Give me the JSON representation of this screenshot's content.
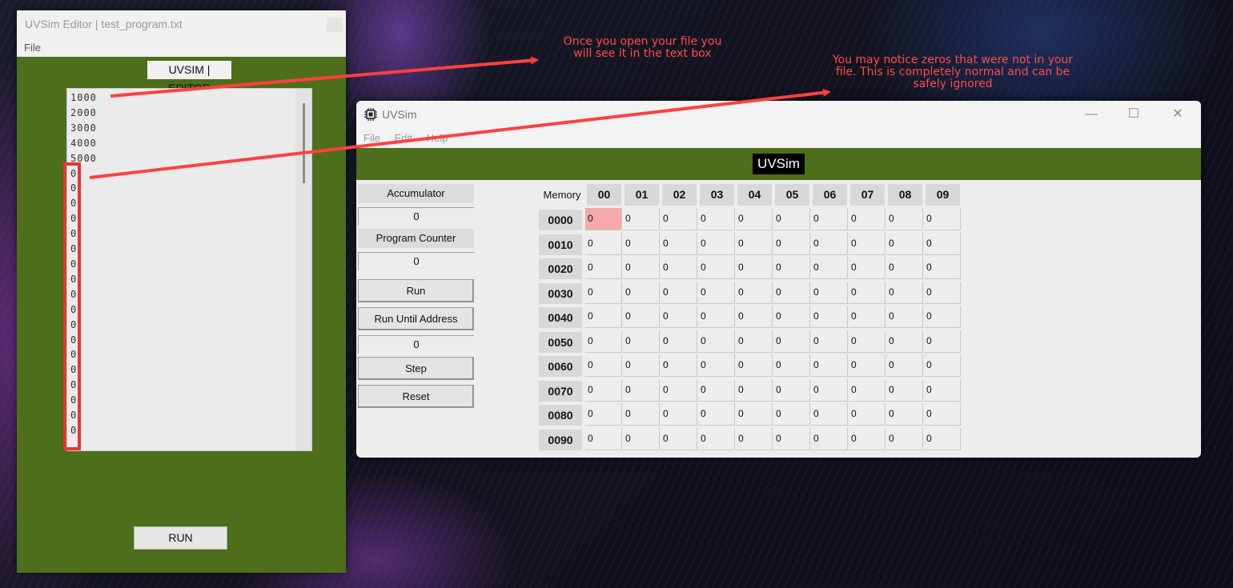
{
  "editor": {
    "window_title": "UVSim Editor | test_program.txt",
    "menu": [
      "File"
    ],
    "banner": "UVSIM | EDITOR",
    "lines": [
      "1000",
      "2000",
      "3000",
      "4000",
      "5000",
      "0",
      "0",
      "0",
      "0",
      "0",
      "0",
      "0",
      "0",
      "0",
      "0",
      "0",
      "0",
      "0",
      "0",
      "0",
      "0",
      "0",
      "0"
    ],
    "run_label": "RUN"
  },
  "uvsim": {
    "window_title": "UVSim",
    "menu": [
      "File",
      "Edit",
      "Help"
    ],
    "banner": "UVSim",
    "accumulator_label": "Accumulator",
    "accumulator_value": "0",
    "program_counter_label": "Program Counter",
    "program_counter_value": "0",
    "run_label": "Run",
    "run_until_label": "Run Until Address",
    "run_until_value": "0",
    "step_label": "Step",
    "reset_label": "Reset",
    "memory_label": "Memory",
    "columns": [
      "00",
      "01",
      "02",
      "03",
      "04",
      "05",
      "06",
      "07",
      "08",
      "09"
    ],
    "rows": [
      {
        "addr": "0000",
        "values": [
          "0",
          "0",
          "0",
          "0",
          "0",
          "0",
          "0",
          "0",
          "0",
          "0"
        ]
      },
      {
        "addr": "0010",
        "values": [
          "0",
          "0",
          "0",
          "0",
          "0",
          "0",
          "0",
          "0",
          "0",
          "0"
        ]
      },
      {
        "addr": "0020",
        "values": [
          "0",
          "0",
          "0",
          "0",
          "0",
          "0",
          "0",
          "0",
          "0",
          "0"
        ]
      },
      {
        "addr": "0030",
        "values": [
          "0",
          "0",
          "0",
          "0",
          "0",
          "0",
          "0",
          "0",
          "0",
          "0"
        ]
      },
      {
        "addr": "0040",
        "values": [
          "0",
          "0",
          "0",
          "0",
          "0",
          "0",
          "0",
          "0",
          "0",
          "0"
        ]
      },
      {
        "addr": "0050",
        "values": [
          "0",
          "0",
          "0",
          "0",
          "0",
          "0",
          "0",
          "0",
          "0",
          "0"
        ]
      },
      {
        "addr": "0060",
        "values": [
          "0",
          "0",
          "0",
          "0",
          "0",
          "0",
          "0",
          "0",
          "0",
          "0"
        ]
      },
      {
        "addr": "0070",
        "values": [
          "0",
          "0",
          "0",
          "0",
          "0",
          "0",
          "0",
          "0",
          "0",
          "0"
        ]
      },
      {
        "addr": "0080",
        "values": [
          "0",
          "0",
          "0",
          "0",
          "0",
          "0",
          "0",
          "0",
          "0",
          "0"
        ]
      },
      {
        "addr": "0090",
        "values": [
          "0",
          "0",
          "0",
          "0",
          "0",
          "0",
          "0",
          "0",
          "0",
          "0"
        ]
      }
    ],
    "active_cell": "0000-00"
  },
  "annotations": {
    "note_open_file": "Once you open your file you will see it in the text box",
    "note_zeros": "You may notice zeros that were not in your file. This is completely normal and can be safely ignored",
    "color": "#ff4a4a"
  },
  "colors": {
    "banner_green": "#4d6e1b",
    "active_cell": "#f6a9a9"
  }
}
